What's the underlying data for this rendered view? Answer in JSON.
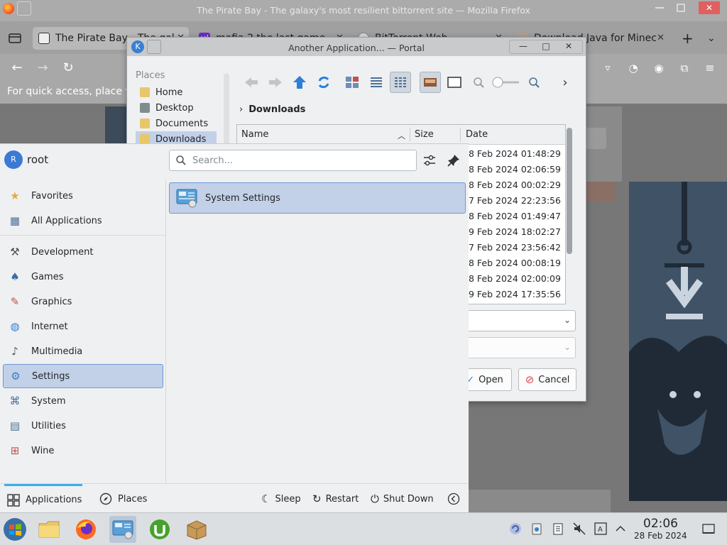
{
  "firefox": {
    "window_title": "The Pirate Bay - The galaxy's most resilient bittorrent site — Mozilla Firefox",
    "tabs": [
      {
        "label": "The Pirate Bay - The gal"
      },
      {
        "label": "mafia 2 the last game - "
      },
      {
        "label": "BitTorrent Web"
      },
      {
        "label": "Download Java for Minec"
      }
    ],
    "bookmarks_hint": "For quick access, place yo"
  },
  "dialog": {
    "title": "Another Application... — Portal",
    "places_header": "Places",
    "places": [
      {
        "label": "Home"
      },
      {
        "label": "Desktop"
      },
      {
        "label": "Documents"
      },
      {
        "label": "Downloads"
      }
    ],
    "breadcrumb": "Downloads",
    "columns": {
      "name": "Name",
      "size": "Size",
      "date": "Date"
    },
    "dates": [
      "8 Feb 2024 01:48:29",
      "8 Feb 2024 02:06:59",
      "8 Feb 2024 00:02:29",
      "7 Feb 2024 22:23:56",
      "8 Feb 2024 01:49:47",
      "9 Feb 2024 18:02:27",
      "7 Feb 2024 23:56:42",
      "8 Feb 2024 00:08:19",
      "8 Feb 2024 02:00:09",
      "9 Feb 2024 17:35:56"
    ],
    "open_label": "Open",
    "cancel_label": "Cancel"
  },
  "launcher": {
    "user": "root",
    "avatar_initial": "R",
    "search_placeholder": "Search...",
    "categories": [
      {
        "label": "Favorites",
        "icon": "favorites-icon"
      },
      {
        "label": "All Applications",
        "icon": "all-apps-icon"
      },
      {
        "label": "Development",
        "icon": "development-icon"
      },
      {
        "label": "Games",
        "icon": "games-icon"
      },
      {
        "label": "Graphics",
        "icon": "graphics-icon"
      },
      {
        "label": "Internet",
        "icon": "internet-icon"
      },
      {
        "label": "Multimedia",
        "icon": "multimedia-icon"
      },
      {
        "label": "Settings",
        "icon": "settings-icon"
      },
      {
        "label": "System",
        "icon": "system-icon"
      },
      {
        "label": "Utilities",
        "icon": "utilities-icon"
      },
      {
        "label": "Wine",
        "icon": "wine-icon"
      }
    ],
    "selected_category": "Settings",
    "result": "System Settings",
    "footer": {
      "applications": "Applications",
      "places": "Places",
      "sleep": "Sleep",
      "restart": "Restart",
      "shutdown": "Shut Down"
    }
  },
  "taskbar": {
    "time": "02:06",
    "date": "28 Feb 2024"
  },
  "colors": {
    "accent": "#3daee9",
    "selection": "#c2d1e8",
    "selection_border": "#6e98d4",
    "panel": "#eff0f1"
  }
}
